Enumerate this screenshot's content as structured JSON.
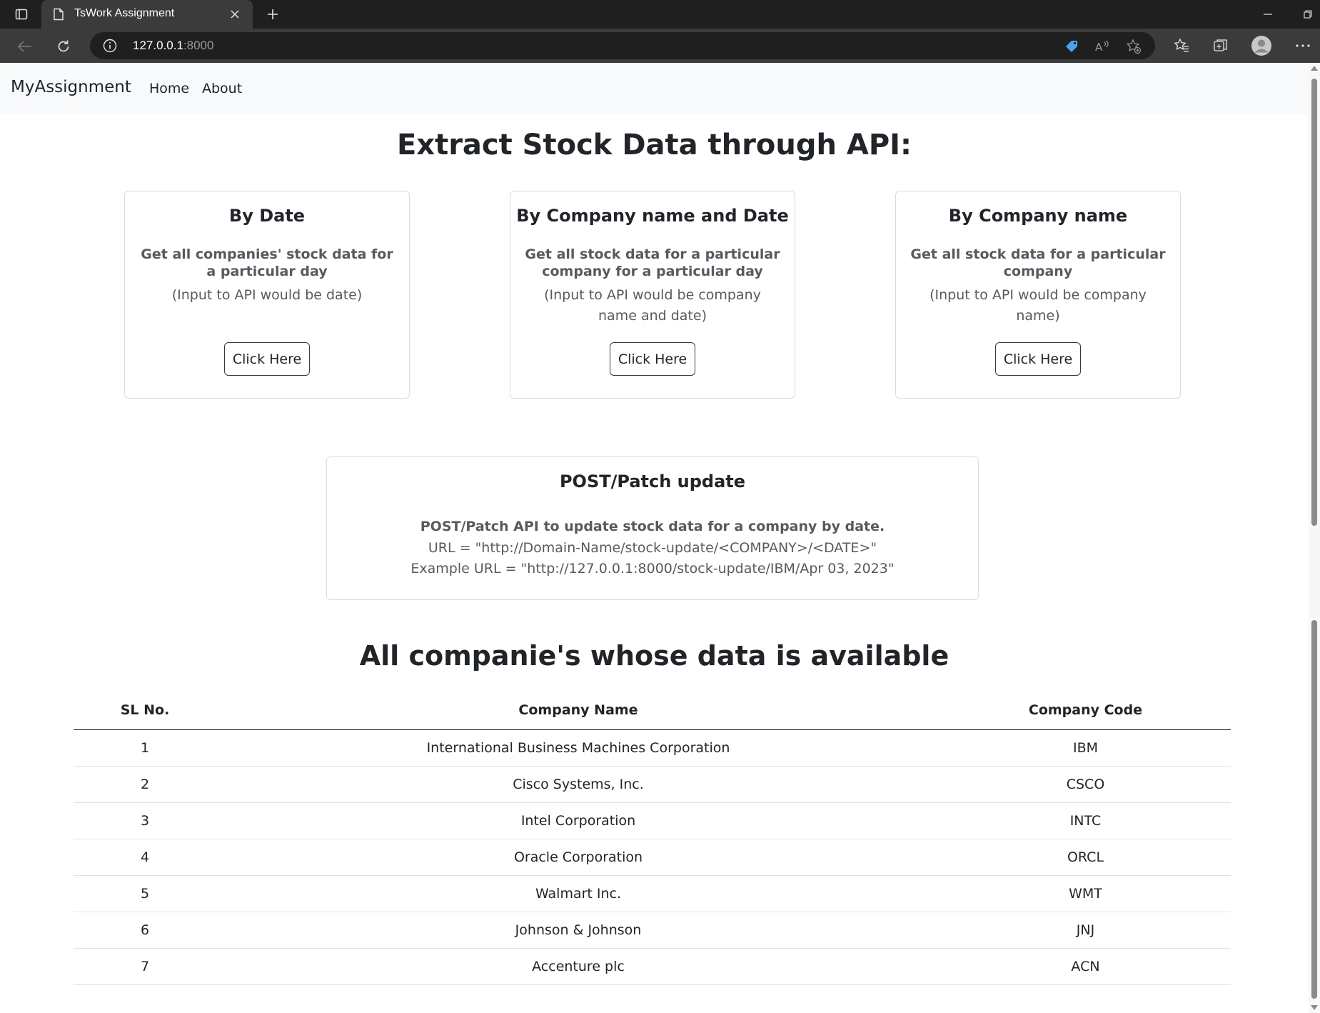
{
  "browser": {
    "tab_title": "TsWork Assignment",
    "url_host": "127.0.0.1",
    "url_port": ":8000"
  },
  "navbar": {
    "brand": "MyAssignment",
    "links": [
      "Home",
      "About"
    ]
  },
  "main": {
    "heading": "Extract Stock Data through API:",
    "cards": [
      {
        "title": "By Date",
        "description": "Get all companies' stock data for a particular day",
        "note": "(Input to API would be date)",
        "button": "Click Here"
      },
      {
        "title": "By Company name and Date",
        "description": "Get all stock data for a particular company for a particular day",
        "note": "(Input to API would be company name and date)",
        "button": "Click Here"
      },
      {
        "title": "By Company name",
        "description": "Get all stock data for a particular company",
        "note": "(Input to API would be company name)",
        "button": "Click Here"
      }
    ],
    "update_card": {
      "title": "POST/Patch update",
      "description": "POST/Patch API to update stock data for a company by date.",
      "url_line": "URL = \"http://Domain-Name/stock-update/<COMPANY>/<DATE>\"",
      "example_line": "Example URL = \"http://127.0.0.1:8000/stock-update/IBM/Apr 03, 2023\""
    }
  },
  "companies": {
    "heading": "All companie's whose data is available",
    "columns": [
      "SL No.",
      "Company Name",
      "Company Code"
    ],
    "rows": [
      [
        "1",
        "International Business Machines Corporation",
        "IBM"
      ],
      [
        "2",
        "Cisco Systems, Inc.",
        "CSCO"
      ],
      [
        "3",
        "Intel Corporation",
        "INTC"
      ],
      [
        "4",
        "Oracle Corporation",
        "ORCL"
      ],
      [
        "5",
        "Walmart Inc.",
        "WMT"
      ],
      [
        "6",
        "Johnson & Johnson",
        "JNJ"
      ],
      [
        "7",
        "Accenture plc",
        "ACN"
      ]
    ]
  }
}
